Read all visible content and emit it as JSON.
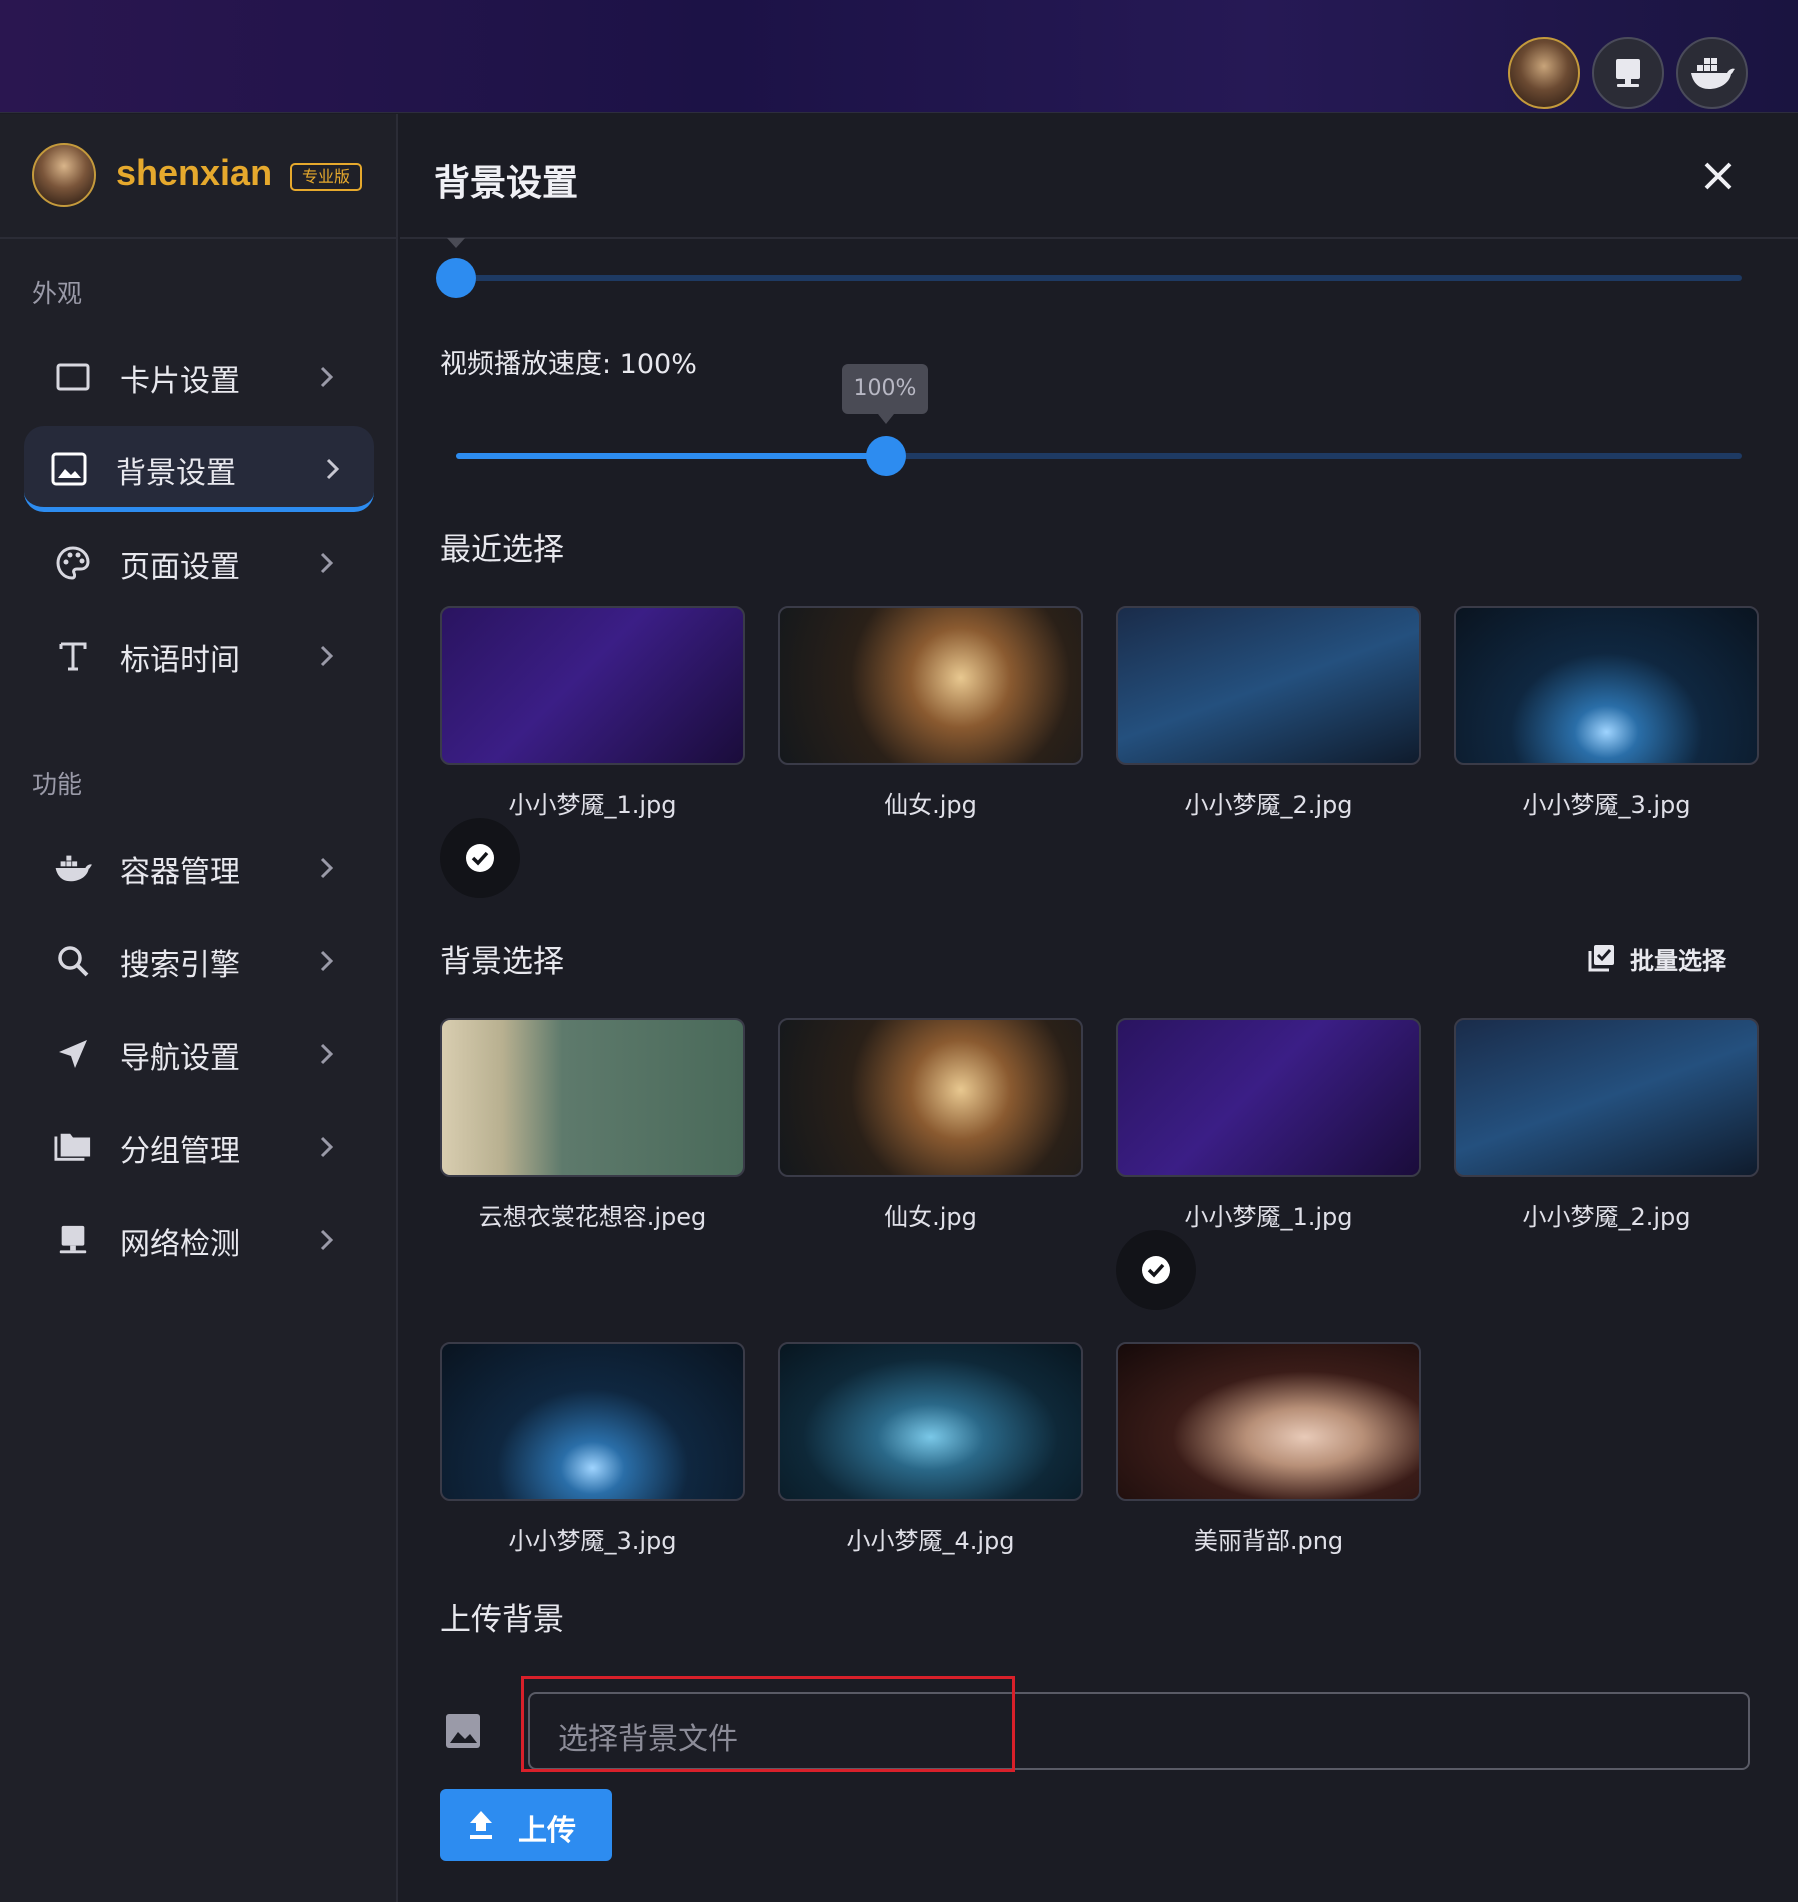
{
  "user": {
    "name": "shenxian",
    "badge": "专业版"
  },
  "top_icons": [
    "avatar",
    "monitor-icon",
    "docker-icon"
  ],
  "sidebar": {
    "sections": [
      {
        "label": "外观",
        "items": [
          {
            "label": "卡片设置",
            "icon": "card-icon",
            "active": false
          },
          {
            "label": "背景设置",
            "icon": "image-icon",
            "active": true
          },
          {
            "label": "页面设置",
            "icon": "palette-icon",
            "active": false
          },
          {
            "label": "标语时间",
            "icon": "text-icon",
            "active": false
          }
        ]
      },
      {
        "label": "功能",
        "items": [
          {
            "label": "容器管理",
            "icon": "docker-icon",
            "active": false
          },
          {
            "label": "搜索引擎",
            "icon": "search-icon",
            "active": false
          },
          {
            "label": "导航设置",
            "icon": "navigation-icon",
            "active": false
          },
          {
            "label": "分组管理",
            "icon": "folder-icon",
            "active": false
          },
          {
            "label": "网络检测",
            "icon": "monitor-icon",
            "active": false
          }
        ]
      }
    ]
  },
  "panel": {
    "title": "背景设置",
    "opacity_slider": {
      "value_fraction": 0.0
    },
    "speed": {
      "label": "视频播放速度: 100%",
      "tooltip": "100%",
      "value_fraction": 0.335
    },
    "recent": {
      "title": "最近选择",
      "items": [
        {
          "name": "小小梦魇_1.jpg",
          "scene": "purple",
          "selected": true
        },
        {
          "name": "仙女.jpg",
          "scene": "fairy",
          "selected": false
        },
        {
          "name": "小小梦魇_2.jpg",
          "scene": "blue-house",
          "selected": false
        },
        {
          "name": "小小梦魇_3.jpg",
          "scene": "blue-hall",
          "selected": false
        }
      ]
    },
    "backgrounds": {
      "title": "背景选择",
      "batch_label": "批量选择",
      "items": [
        {
          "name": "云想衣裳花想容.jpeg",
          "scene": "lady",
          "selected": false
        },
        {
          "name": "仙女.jpg",
          "scene": "fairy",
          "selected": false
        },
        {
          "name": "小小梦魇_1.jpg",
          "scene": "purple",
          "selected": true
        },
        {
          "name": "小小梦魇_2.jpg",
          "scene": "blue-house",
          "selected": false
        },
        {
          "name": "小小梦魇_3.jpg",
          "scene": "blue-hall",
          "selected": false
        },
        {
          "name": "小小梦魇_4.jpg",
          "scene": "tower",
          "selected": false
        },
        {
          "name": "美丽背部.png",
          "scene": "back",
          "selected": false
        }
      ]
    },
    "upload": {
      "title": "上传背景",
      "placeholder": "选择背景文件",
      "button_label": "上传"
    }
  },
  "colors": {
    "accent": "#2d8cf0",
    "gold": "#e6a92d",
    "highlight_box": "#d9202a"
  }
}
